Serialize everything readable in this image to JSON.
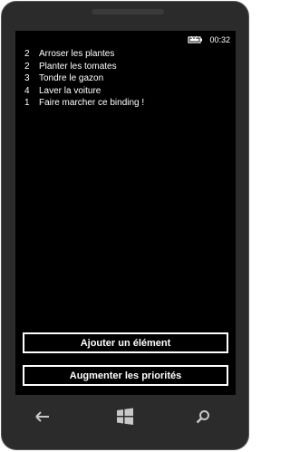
{
  "status_bar": {
    "time": "00:32"
  },
  "items": [
    {
      "priority": "2",
      "label": "Arroser les plantes"
    },
    {
      "priority": "2",
      "label": "Planter les tomates"
    },
    {
      "priority": "3",
      "label": "Tondre le gazon"
    },
    {
      "priority": "4",
      "label": "Laver la voiture"
    },
    {
      "priority": "1",
      "label": "Faire marcher ce binding !"
    }
  ],
  "buttons": {
    "add_label": "Ajouter un élément",
    "increase_label": "Augmenter les priorités"
  },
  "colors": {
    "screen_background": "#000000",
    "text": "#ffffff",
    "phone_body": "#2b2b2b"
  },
  "icons": {
    "battery": "battery-icon",
    "back": "back-arrow-icon",
    "start": "windows-start-icon",
    "search": "search-icon"
  }
}
